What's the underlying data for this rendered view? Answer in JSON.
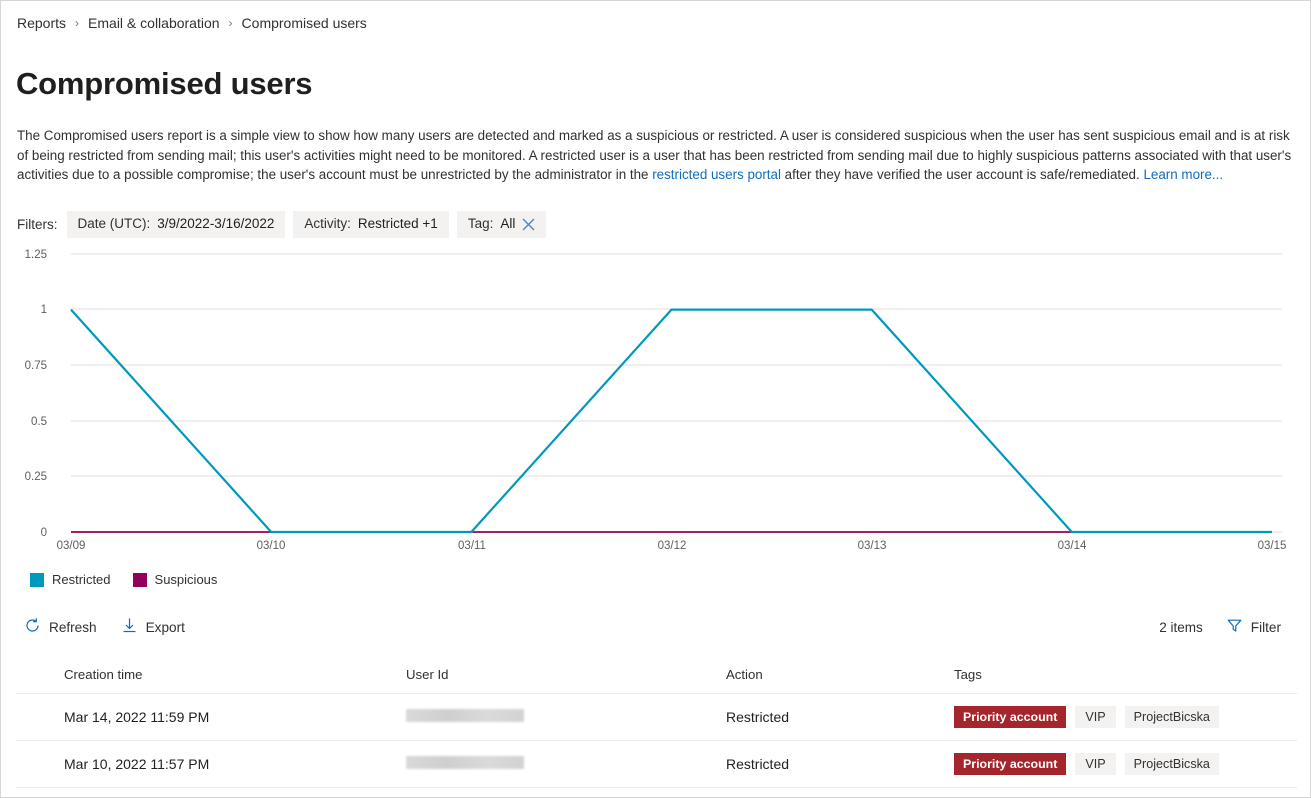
{
  "breadcrumb": {
    "items": [
      {
        "label": "Reports"
      },
      {
        "label": "Email & collaboration"
      },
      {
        "label": "Compromised users"
      }
    ],
    "separator": "›"
  },
  "page_title": "Compromised users",
  "description": {
    "part1": "The Compromised users report is a simple view to show how many users are detected and marked as a suspicious or restricted. A user is considered suspicious when the user has sent suspicious email and is at risk of being restricted from sending mail; this user's activities might need to be monitored. A restricted user is a user that has been restricted from sending mail due to highly suspicious patterns associated with that user's activities due to a possible compromise; the user's account must be unrestricted by the administrator in the ",
    "link1": "restricted users portal",
    "part2": " after they have verified the user account is safe/remediated. ",
    "link2": "Learn more..."
  },
  "filters": {
    "label": "Filters:",
    "chips": [
      {
        "key": "Date (UTC):",
        "value": "3/9/2022-3/16/2022",
        "closable": false
      },
      {
        "key": "Activity:",
        "value": "Restricted +1",
        "closable": false
      },
      {
        "key": "Tag:",
        "value": "All",
        "closable": true,
        "close_icon": "close-icon"
      }
    ]
  },
  "chart_data": {
    "type": "line",
    "title": "",
    "xlabel": "",
    "ylabel": "",
    "x": [
      "03/09",
      "03/10",
      "03/11",
      "03/12",
      "03/13",
      "03/14",
      "03/15"
    ],
    "ytick_labels": [
      "0",
      "0.25",
      "0.5",
      "0.75",
      "1",
      "1.25"
    ],
    "yticks": [
      0,
      0.25,
      0.5,
      0.75,
      1,
      1.25
    ],
    "ylim": [
      0,
      1.25
    ],
    "grid": true,
    "legend_position": "bottom-left",
    "series": [
      {
        "name": "Restricted",
        "color": "#0099bc",
        "values": [
          1,
          0,
          0,
          1,
          1,
          0,
          0
        ]
      },
      {
        "name": "Suspicious",
        "color": "#93005a",
        "values": [
          0,
          0,
          0,
          0,
          0,
          0,
          0
        ]
      }
    ]
  },
  "legend": [
    {
      "label": "Restricted",
      "color": "#0099bc"
    },
    {
      "label": "Suspicious",
      "color": "#93005a"
    }
  ],
  "commandbar": {
    "refresh_label": "Refresh",
    "export_label": "Export",
    "items_count": "2 items",
    "filter_label": "Filter"
  },
  "table": {
    "columns": [
      "Creation time",
      "User Id",
      "Action",
      "Tags"
    ],
    "rows": [
      {
        "creation_time": "Mar 14, 2022 11:59 PM",
        "user_id": "",
        "action": "Restricted",
        "tags": [
          "Priority account",
          "VIP",
          "ProjectBicska"
        ]
      },
      {
        "creation_time": "Mar 10, 2022 11:57 PM",
        "user_id": "",
        "action": "Restricted",
        "tags": [
          "Priority account",
          "VIP",
          "ProjectBicska"
        ]
      }
    ]
  },
  "colors": {
    "restricted": "#0099bc",
    "suspicious": "#93005a",
    "priority_tag_bg": "#a4262c",
    "link": "#0f6cbd",
    "chip_bg": "#f3f2f1"
  }
}
